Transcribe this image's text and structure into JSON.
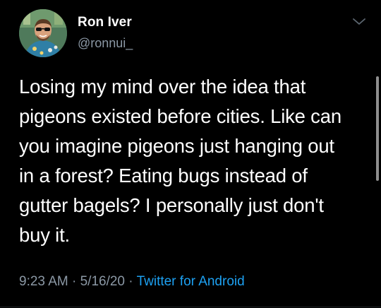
{
  "author": {
    "display_name": "Ron Iver",
    "handle": "@ronnui_",
    "avatar": "avatar-photo"
  },
  "tweet": {
    "lines": [
      "Losing my mind over the idea that",
      "pigeons existed before cities. Like can",
      "you imagine pigeons just hanging out",
      "in a forest? Eating bugs instead of",
      "gutter bagels? I personally just don't",
      "buy it."
    ]
  },
  "meta": {
    "time": "9:23 AM",
    "separator": "·",
    "date": "5/16/20",
    "source": "Twitter for Android"
  },
  "icons": {
    "menu": "chevron-down-icon"
  },
  "colors": {
    "background": "#000000",
    "primary_text": "#ffffff",
    "secondary_text": "#8b98a5",
    "link": "#1da1f2"
  }
}
